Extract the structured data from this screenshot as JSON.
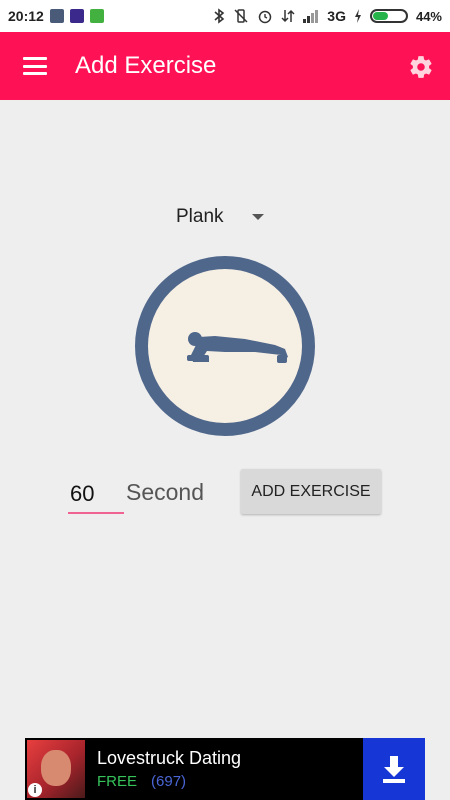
{
  "status_bar": {
    "time": "20:12",
    "network": "3G",
    "battery": "44%"
  },
  "app_bar": {
    "title": "Add Exercise"
  },
  "exercise": {
    "selected": "Plank",
    "duration_value": "60",
    "unit_label": "Second",
    "add_button_label": "ADD EXERCISE"
  },
  "ad": {
    "title": "Lovestruck Dating",
    "price": "FREE",
    "count": "(697)"
  },
  "colors": {
    "accent": "#ff1255",
    "circle_ring": "#50678c",
    "circle_fill": "#f6efe4"
  }
}
